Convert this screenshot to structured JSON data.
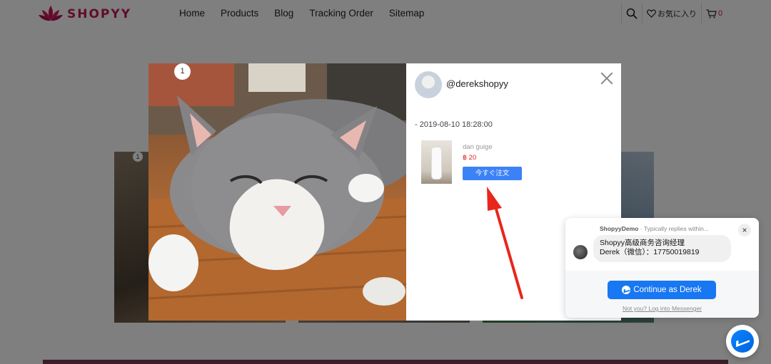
{
  "brand": {
    "name": "SHOPYY",
    "color": "#c2185b"
  },
  "nav": {
    "items": [
      "Home",
      "Products",
      "Blog",
      "Tracking Order",
      "Sitemap"
    ]
  },
  "header_tools": {
    "search_icon": "search-icon",
    "wishlist_label": "お気に入り",
    "cart_count": "0"
  },
  "gallery": {
    "badge": "1"
  },
  "modal": {
    "photo_index": "1",
    "username": "@derekshopyy",
    "timestamp": "- 2019-08-10 18:28:00",
    "product": {
      "name": "dan guige",
      "price": "฿ 20",
      "buy_label": "今すぐ注文"
    }
  },
  "messenger": {
    "page_name": "ShopyyDemo",
    "reply_time": " · Typically replies within...",
    "message_line1": "Shopyy高级商务咨询经理",
    "message_line2": "Derek（微信）：17750019819",
    "continue_label": "Continue as Derek",
    "alt_link": "Not you? Log into Messenger"
  },
  "colors": {
    "accent_blue": "#1877f2",
    "price_red": "#e02020",
    "annotation_arrow": "#e8261c"
  }
}
